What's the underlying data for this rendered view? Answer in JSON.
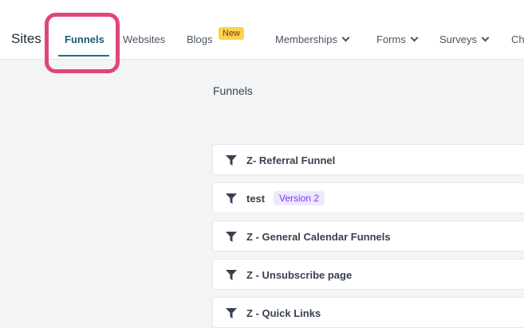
{
  "header": {
    "site_title": "Sites",
    "nav": {
      "funnels": "Funnels",
      "websites": "Websites",
      "blogs": "Blogs",
      "blogs_badge": "New",
      "memberships": "Memberships",
      "forms": "Forms",
      "surveys": "Surveys",
      "truncated": "Ch"
    }
  },
  "main": {
    "section_title": "Funnels",
    "funnels": [
      {
        "name": "Z- Referral Funnel"
      },
      {
        "name": "test",
        "badge": "Version 2"
      },
      {
        "name": "Z - General Calendar Funnels"
      },
      {
        "name": "Z - Unsubscribe page"
      },
      {
        "name": "Z - Quick Links"
      }
    ]
  },
  "colors": {
    "active_tab": "#0e7490",
    "highlight": "#e2457a",
    "new_badge": "#fcd34d",
    "version_badge": "#ede9fe"
  }
}
